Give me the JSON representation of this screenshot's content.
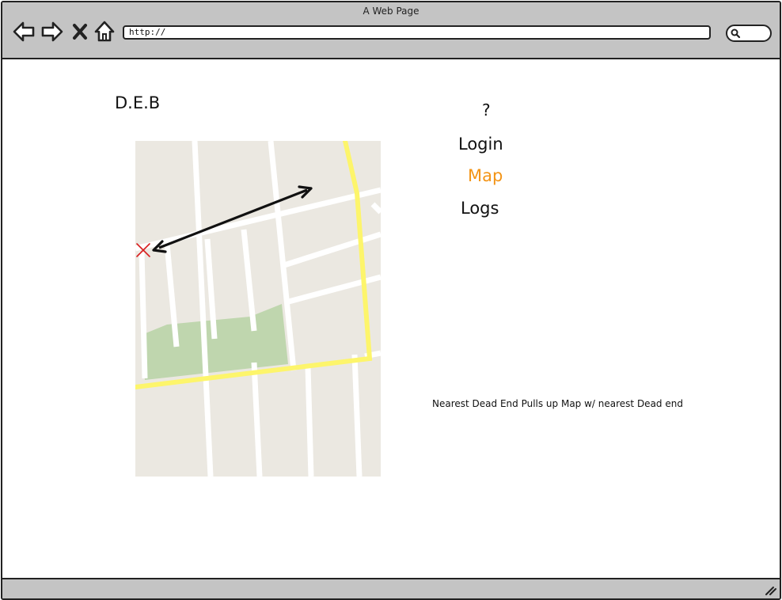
{
  "window": {
    "title": "A Web Page"
  },
  "toolbar": {
    "back_icon": "back-arrow-icon",
    "forward_icon": "forward-arrow-icon",
    "stop_icon": "close-x-icon",
    "home_icon": "home-icon",
    "url": "http://",
    "search_icon": "search-icon"
  },
  "page": {
    "site_title": "D.E.B",
    "help_label": "?",
    "nav": {
      "login": "Login",
      "map": "Map",
      "logs": "Logs"
    },
    "annotation": "Nearest Dead End Pulls up Map w/ nearest Dead end"
  },
  "map": {
    "marker_icon": "x-marker-icon",
    "direction_icon": "double-arrow-icon"
  },
  "colors": {
    "chrome": "#c4c4c4",
    "active_nav": "#f39416",
    "map_land": "#ebe8e1",
    "map_road": "#ffffff",
    "map_highway": "#fdf56b",
    "map_park": "#bfd6ae",
    "marker": "#d81f1f"
  }
}
